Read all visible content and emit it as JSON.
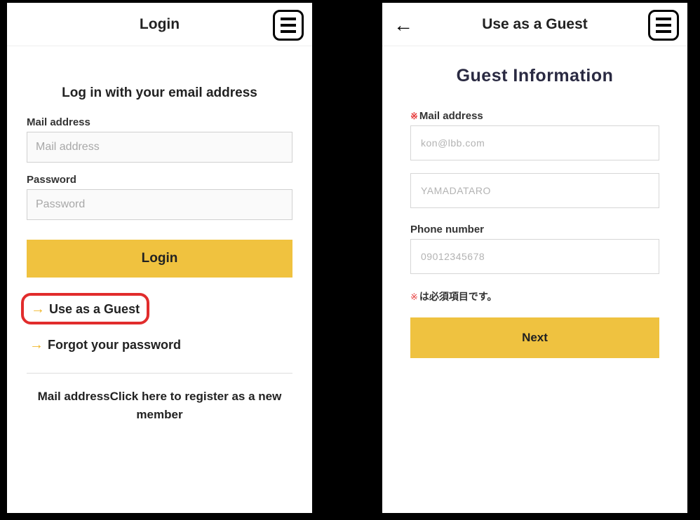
{
  "left": {
    "header_title": "Login",
    "section_title": "Log in with your email address",
    "mail_label": "Mail address",
    "mail_placeholder": "Mail address",
    "password_label": "Password",
    "password_placeholder": "Password",
    "login_button": "Login",
    "guest_link": "Use as a Guest",
    "forgot_link": "Forgot your password",
    "register_text": "Mail addressClick here to register as a new member"
  },
  "right": {
    "header_title": "Use as a Guest",
    "section_title": "Guest Information",
    "required_mark": "※",
    "mail_label": "Mail address",
    "mail_placeholder": "kon@lbb.com",
    "name_placeholder": "YAMADATARO",
    "phone_label": "Phone number",
    "phone_placeholder": "09012345678",
    "required_note": "は必須項目です。",
    "next_button": "Next"
  }
}
